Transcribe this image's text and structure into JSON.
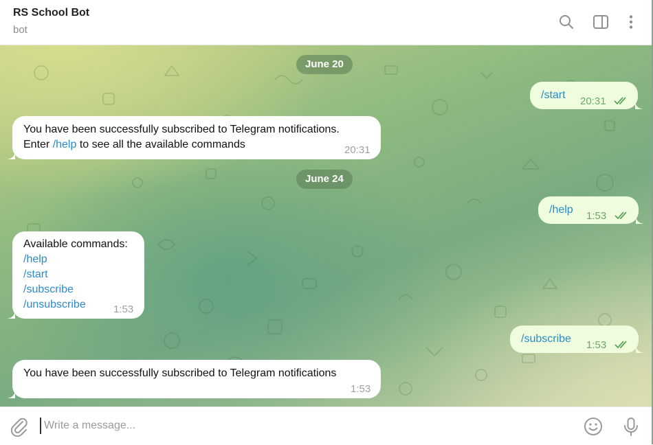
{
  "header": {
    "title": "RS School Bot",
    "subtitle": "bot",
    "icons": [
      "search-icon",
      "sidebar-toggle-icon",
      "more-vertical-icon"
    ]
  },
  "dates": [
    "June 20",
    "June 24"
  ],
  "messages": [
    {
      "dir": "out",
      "text": "/start",
      "time": "20:31"
    },
    {
      "dir": "in",
      "line1": "You have been successfully subscribed to Telegram notifications.",
      "line2_pre": "Enter ",
      "line2_cmd": "/help",
      "line2_post": " to see all the available commands",
      "time": "20:31"
    },
    {
      "dir": "out",
      "text": "/help",
      "time": "1:53"
    },
    {
      "dir": "in",
      "title": "Available commands:",
      "commands": [
        "/help",
        "/start",
        "/subscribe",
        "/unsubscribe"
      ],
      "time": "1:53"
    },
    {
      "dir": "out",
      "text": "/subscribe",
      "time": "1:53"
    },
    {
      "dir": "in",
      "text": "You have been successfully subscribed to Telegram notifications",
      "time": "1:53"
    }
  ],
  "composer": {
    "placeholder": "Write a message...",
    "icons": [
      "attach-icon",
      "emoji-icon",
      "microphone-icon"
    ]
  },
  "colors": {
    "incoming_bubble": "#ffffff",
    "outgoing_bubble": "#effdde",
    "command_link": "#2a8bc7",
    "outgoing_time": "#6ba66b",
    "date_chip": "#6e8c5f"
  }
}
